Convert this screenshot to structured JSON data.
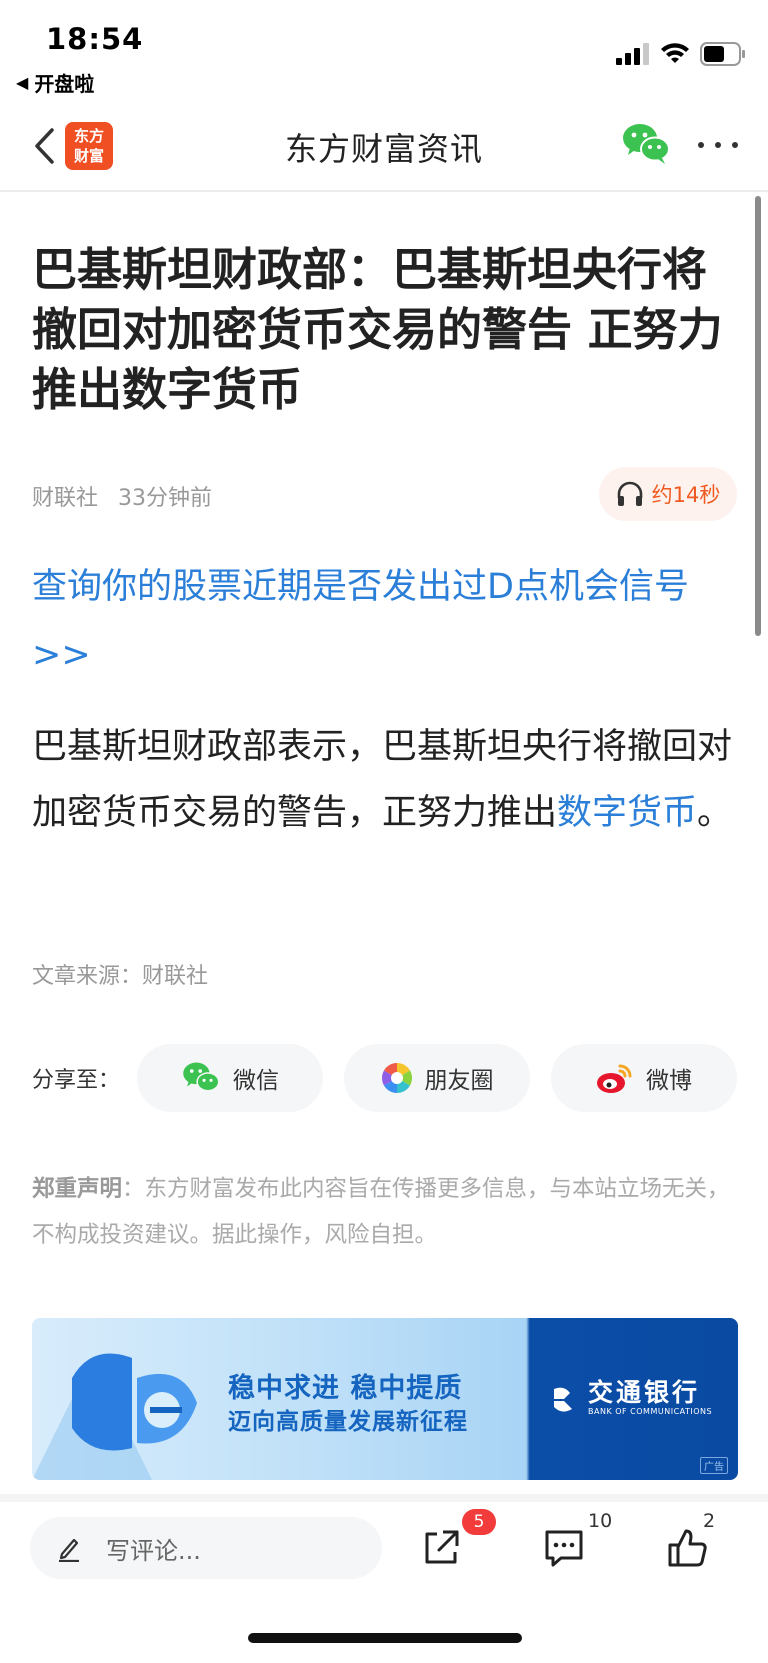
{
  "status_bar": {
    "time": "18:54",
    "back_app": "开盘啦",
    "icons": [
      "signal-icon",
      "wifi-icon",
      "battery-icon"
    ]
  },
  "nav": {
    "logo_text_1": "东方",
    "logo_text_2": "财富",
    "title": "东方财富资讯",
    "icons": [
      "back-chevron-icon",
      "wechat-icon",
      "more-icon"
    ]
  },
  "article": {
    "headline": "巴基斯坦财政部：巴基斯坦央行将撤回对加密货币交易的警告 正努力推出数字货币",
    "source": "财联社",
    "time_ago": "33分钟前",
    "listen_label": "约14秒",
    "promo_link": "查询你的股票近期是否发出过D点机会信号>>",
    "body_prefix": "巴基斯坦财政部表示，巴基斯坦央行将撤回对加密货币交易的警告，正努力推出",
    "body_link": "数字货币",
    "body_suffix": "。",
    "article_source_label": "文章来源：财联社"
  },
  "share": {
    "label": "分享至：",
    "wechat": "微信",
    "moments": "朋友圈",
    "weibo": "微博"
  },
  "disclaimer": {
    "title": "郑重声明",
    "text": "：东方财富发布此内容旨在传播更多信息，与本站立场无关，不构成投资建议。据此操作，风险自担。"
  },
  "banner": {
    "line1": "稳中求进 稳中提质",
    "line2": "迈向高质量发展新征程",
    "bank_cn": "交通银行",
    "bank_en": "BANK OF COMMUNICATIONS",
    "ad_tag": "广告"
  },
  "bottom_bar": {
    "comment_placeholder": "写评论...",
    "share_badge": "5",
    "comment_count": "10",
    "like_count": "2"
  },
  "colors": {
    "accent_blue": "#2b7fd8",
    "brand_orange": "#f04e23",
    "badge_red": "#f23b3b"
  }
}
